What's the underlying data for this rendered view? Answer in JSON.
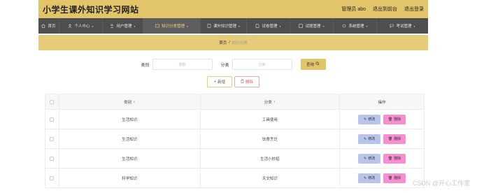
{
  "header": {
    "title": "小学生课外知识学习网站",
    "admin_label": "管理员 abo",
    "back_label": "退出到前台",
    "logout_label": "退出登录"
  },
  "nav": {
    "items": [
      {
        "label": "首页",
        "icon": "home-icon"
      },
      {
        "label": "个人中心",
        "icon": "user-icon"
      },
      {
        "label": "用户管理",
        "icon": "user-manage-icon"
      },
      {
        "label": "知识分类管理",
        "icon": "category-icon"
      },
      {
        "label": "课外知识管理",
        "icon": "book-icon"
      },
      {
        "label": "试卷管理",
        "icon": "paper-icon"
      },
      {
        "label": "试题管理",
        "icon": "question-icon"
      },
      {
        "label": "系统管理",
        "icon": "system-icon"
      },
      {
        "label": "考试管理",
        "icon": "exam-icon"
      }
    ],
    "active_index": 3
  },
  "breadcrumb": {
    "home": "首页",
    "separator": "/",
    "current": "知识分类"
  },
  "search": {
    "type_label": "类别",
    "type_placeholder": "类别",
    "cat_label": "分类",
    "cat_placeholder": "分类",
    "button_label": "查询"
  },
  "actions": {
    "add_label": "新增",
    "delete_label": "删除"
  },
  "table": {
    "headers": {
      "type": "类别",
      "category": "分类",
      "ops": "操作"
    },
    "rows": [
      {
        "type": "生活知识",
        "category": "工具使用"
      },
      {
        "type": "生活知识",
        "category": "饮食烹饪"
      },
      {
        "type": "生活知识",
        "category": "生活小妙招"
      },
      {
        "type": "科学知识",
        "category": "天文知识"
      }
    ],
    "edit_label": "修改",
    "delete_label": "删除"
  },
  "watermark": "CSDN @开心工作室",
  "colors": {
    "accent": "#e2c46b",
    "nav_bg": "#4e4e4e",
    "edit_btn": "#b8c4ea",
    "delete_btn": "#f58fcf"
  }
}
